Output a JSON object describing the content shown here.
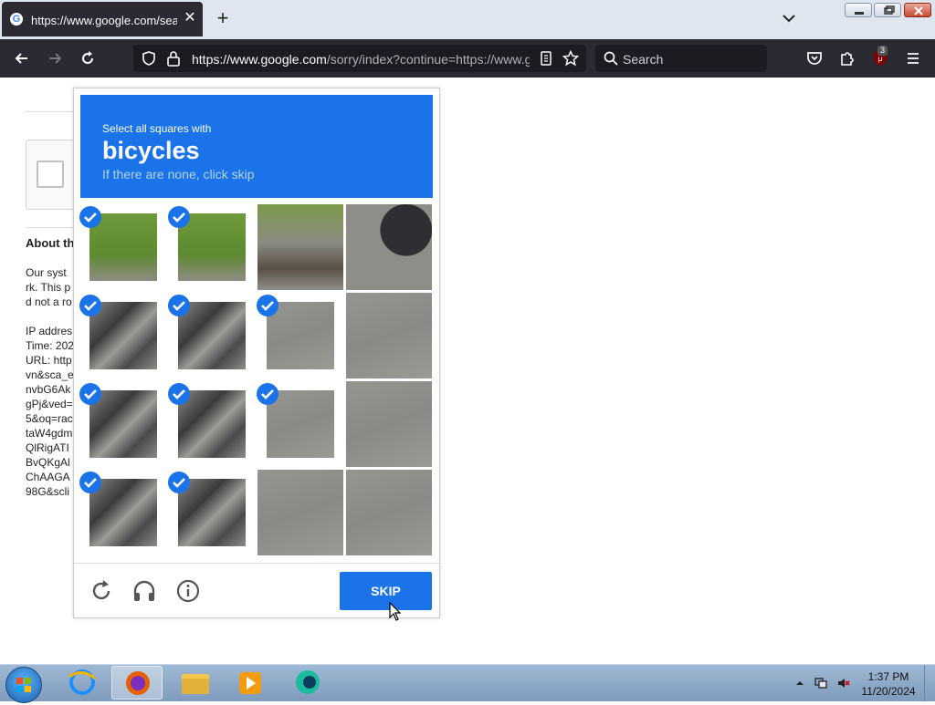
{
  "browser": {
    "tab": {
      "title": "https://www.google.com/search",
      "favicon": "G"
    },
    "url": {
      "host": "https://www.google.com",
      "path": "/sorry/index?continue=https://www.g"
    },
    "search_placeholder": "Search",
    "extension_badge": "3"
  },
  "page": {
    "heading": "About th",
    "paragraph_lines": [
      "Our syst",
      "rk. This p",
      "d not a ro"
    ],
    "info_lines": [
      "IP addres",
      "Time: 202",
      "URL: http",
      "vn&sca_e",
      "nvbG6Ak",
      "gPj&ved=",
      "5&oq=rac",
      "taW4gdm",
      "QlRigATI",
      "BvQKgAl",
      "ChAAGA",
      "98G&scli"
    ]
  },
  "captcha": {
    "instruction_prefix": "Select all squares with",
    "target": "bicycles",
    "instruction_suffix": "If there are none, click skip",
    "skip_label": "SKIP",
    "grid_selected": [
      [
        true,
        true,
        false,
        false
      ],
      [
        true,
        true,
        true,
        false
      ],
      [
        true,
        true,
        true,
        false
      ],
      [
        true,
        true,
        false,
        false
      ]
    ]
  },
  "taskbar": {
    "time": "1:37 PM",
    "date": "11/20/2024"
  },
  "colors": {
    "accent": "#1a73e8",
    "browser_dark": "#2b2a33"
  }
}
